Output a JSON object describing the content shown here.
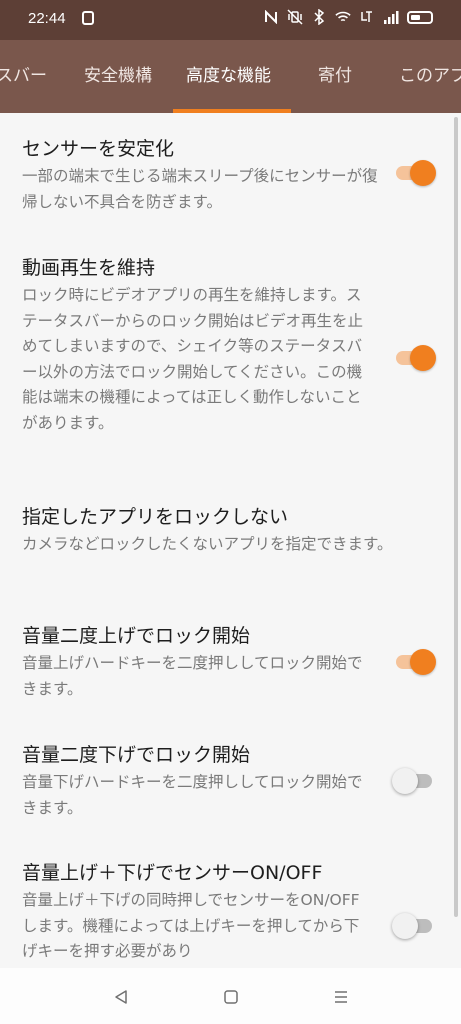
{
  "status": {
    "time": "22:44"
  },
  "tabs": [
    {
      "label": "スバー"
    },
    {
      "label": "安全機構"
    },
    {
      "label": "高度な機能"
    },
    {
      "label": "寄付"
    },
    {
      "label": "このアプ"
    }
  ],
  "active_tab": "高度な機能",
  "colors": {
    "status_bar": "#5d3f36",
    "tab_bar": "#7a574c",
    "accent": "#f07f1f",
    "background": "#f6f6f6"
  },
  "settings": [
    {
      "title": "センサーを安定化",
      "desc": "一部の端末で生じる端末スリープ後にセンサーが復帰しない不具合を防ぎます。",
      "enabled": true
    },
    {
      "title": "動画再生を維持",
      "desc": "ロック時にビデオアプリの再生を維持します。ステータスバーからのロック開始はビデオ再生を止めてしまいますので、シェイク等のステータスバー以外の方法でロック開始してください。この機能は端末の機種によっては正しく動作しないことがあります。",
      "enabled": true
    },
    {
      "title": "指定したアプリをロックしない",
      "desc": "カメラなどロックしたくないアプリを指定できます。"
    },
    {
      "title": "音量二度上げでロック開始",
      "desc": "音量上げハードキーを二度押ししてロック開始できます。",
      "enabled": true
    },
    {
      "title": "音量二度下げでロック開始",
      "desc": "音量下げハードキーを二度押ししてロック開始できます。",
      "enabled": false
    },
    {
      "title": "音量上げ＋下げでセンサーON/OFF",
      "desc": "音量上げ＋下げの同時押しでセンサーをON/OFFします。機種によっては上げキーを押してから下げキーを押す必要があり",
      "enabled": false
    }
  ],
  "icons": {
    "back": "back-triangle-icon",
    "home": "home-square-icon",
    "recents": "menu-lines-icon"
  }
}
